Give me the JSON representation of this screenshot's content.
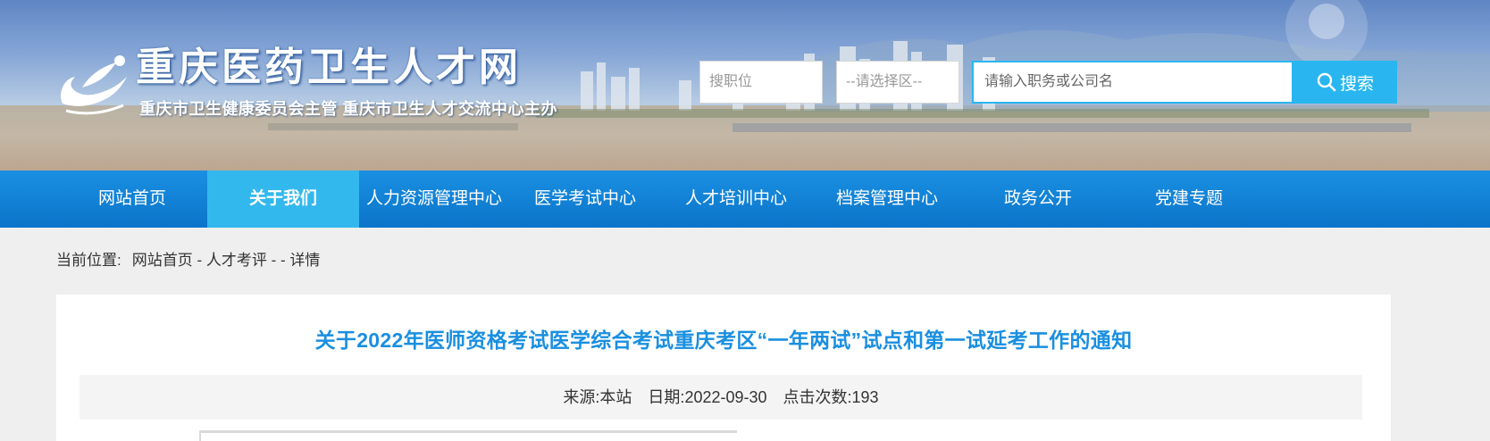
{
  "header": {
    "site_title": "重庆医药卫生人才网",
    "site_subtitle": "重庆市卫生健康委员会主管  重庆市卫生人才交流中心主办",
    "job_select": "搜职位",
    "area_select": "--请选择区--",
    "keyword_placeholder": "请输入职务或公司名",
    "search_label": "搜索"
  },
  "nav": {
    "items": [
      {
        "label": "网站首页"
      },
      {
        "label": "关于我们"
      },
      {
        "label": "人力资源管理中心"
      },
      {
        "label": "医学考试中心"
      },
      {
        "label": "人才培训中心"
      },
      {
        "label": "档案管理中心"
      },
      {
        "label": "政务公开"
      },
      {
        "label": "党建专题"
      }
    ],
    "active_index": 1
  },
  "breadcrumb": {
    "lead": "当前位置:",
    "home": "网站首页",
    "sep1": " - ",
    "section": "人才考评",
    "sep2": " - - ",
    "current": "详情"
  },
  "article": {
    "title": "关于2022年医师资格考试医学综合考试重庆考区“一年两试”试点和第一试延考工作的通知",
    "source_label": "来源:",
    "source_value": "本站",
    "date_label": "日期:",
    "date_value": "2022-09-30",
    "clicks_label": "点击次数:",
    "clicks_value": "193"
  },
  "colors": {
    "nav_bg": "#0b74c9",
    "nav_active": "#33b8ee",
    "title_blue": "#1a8fe0",
    "search_blue": "#29b6f0"
  },
  "icons": {
    "logo": "bird-logo-icon",
    "search": "search-icon"
  }
}
